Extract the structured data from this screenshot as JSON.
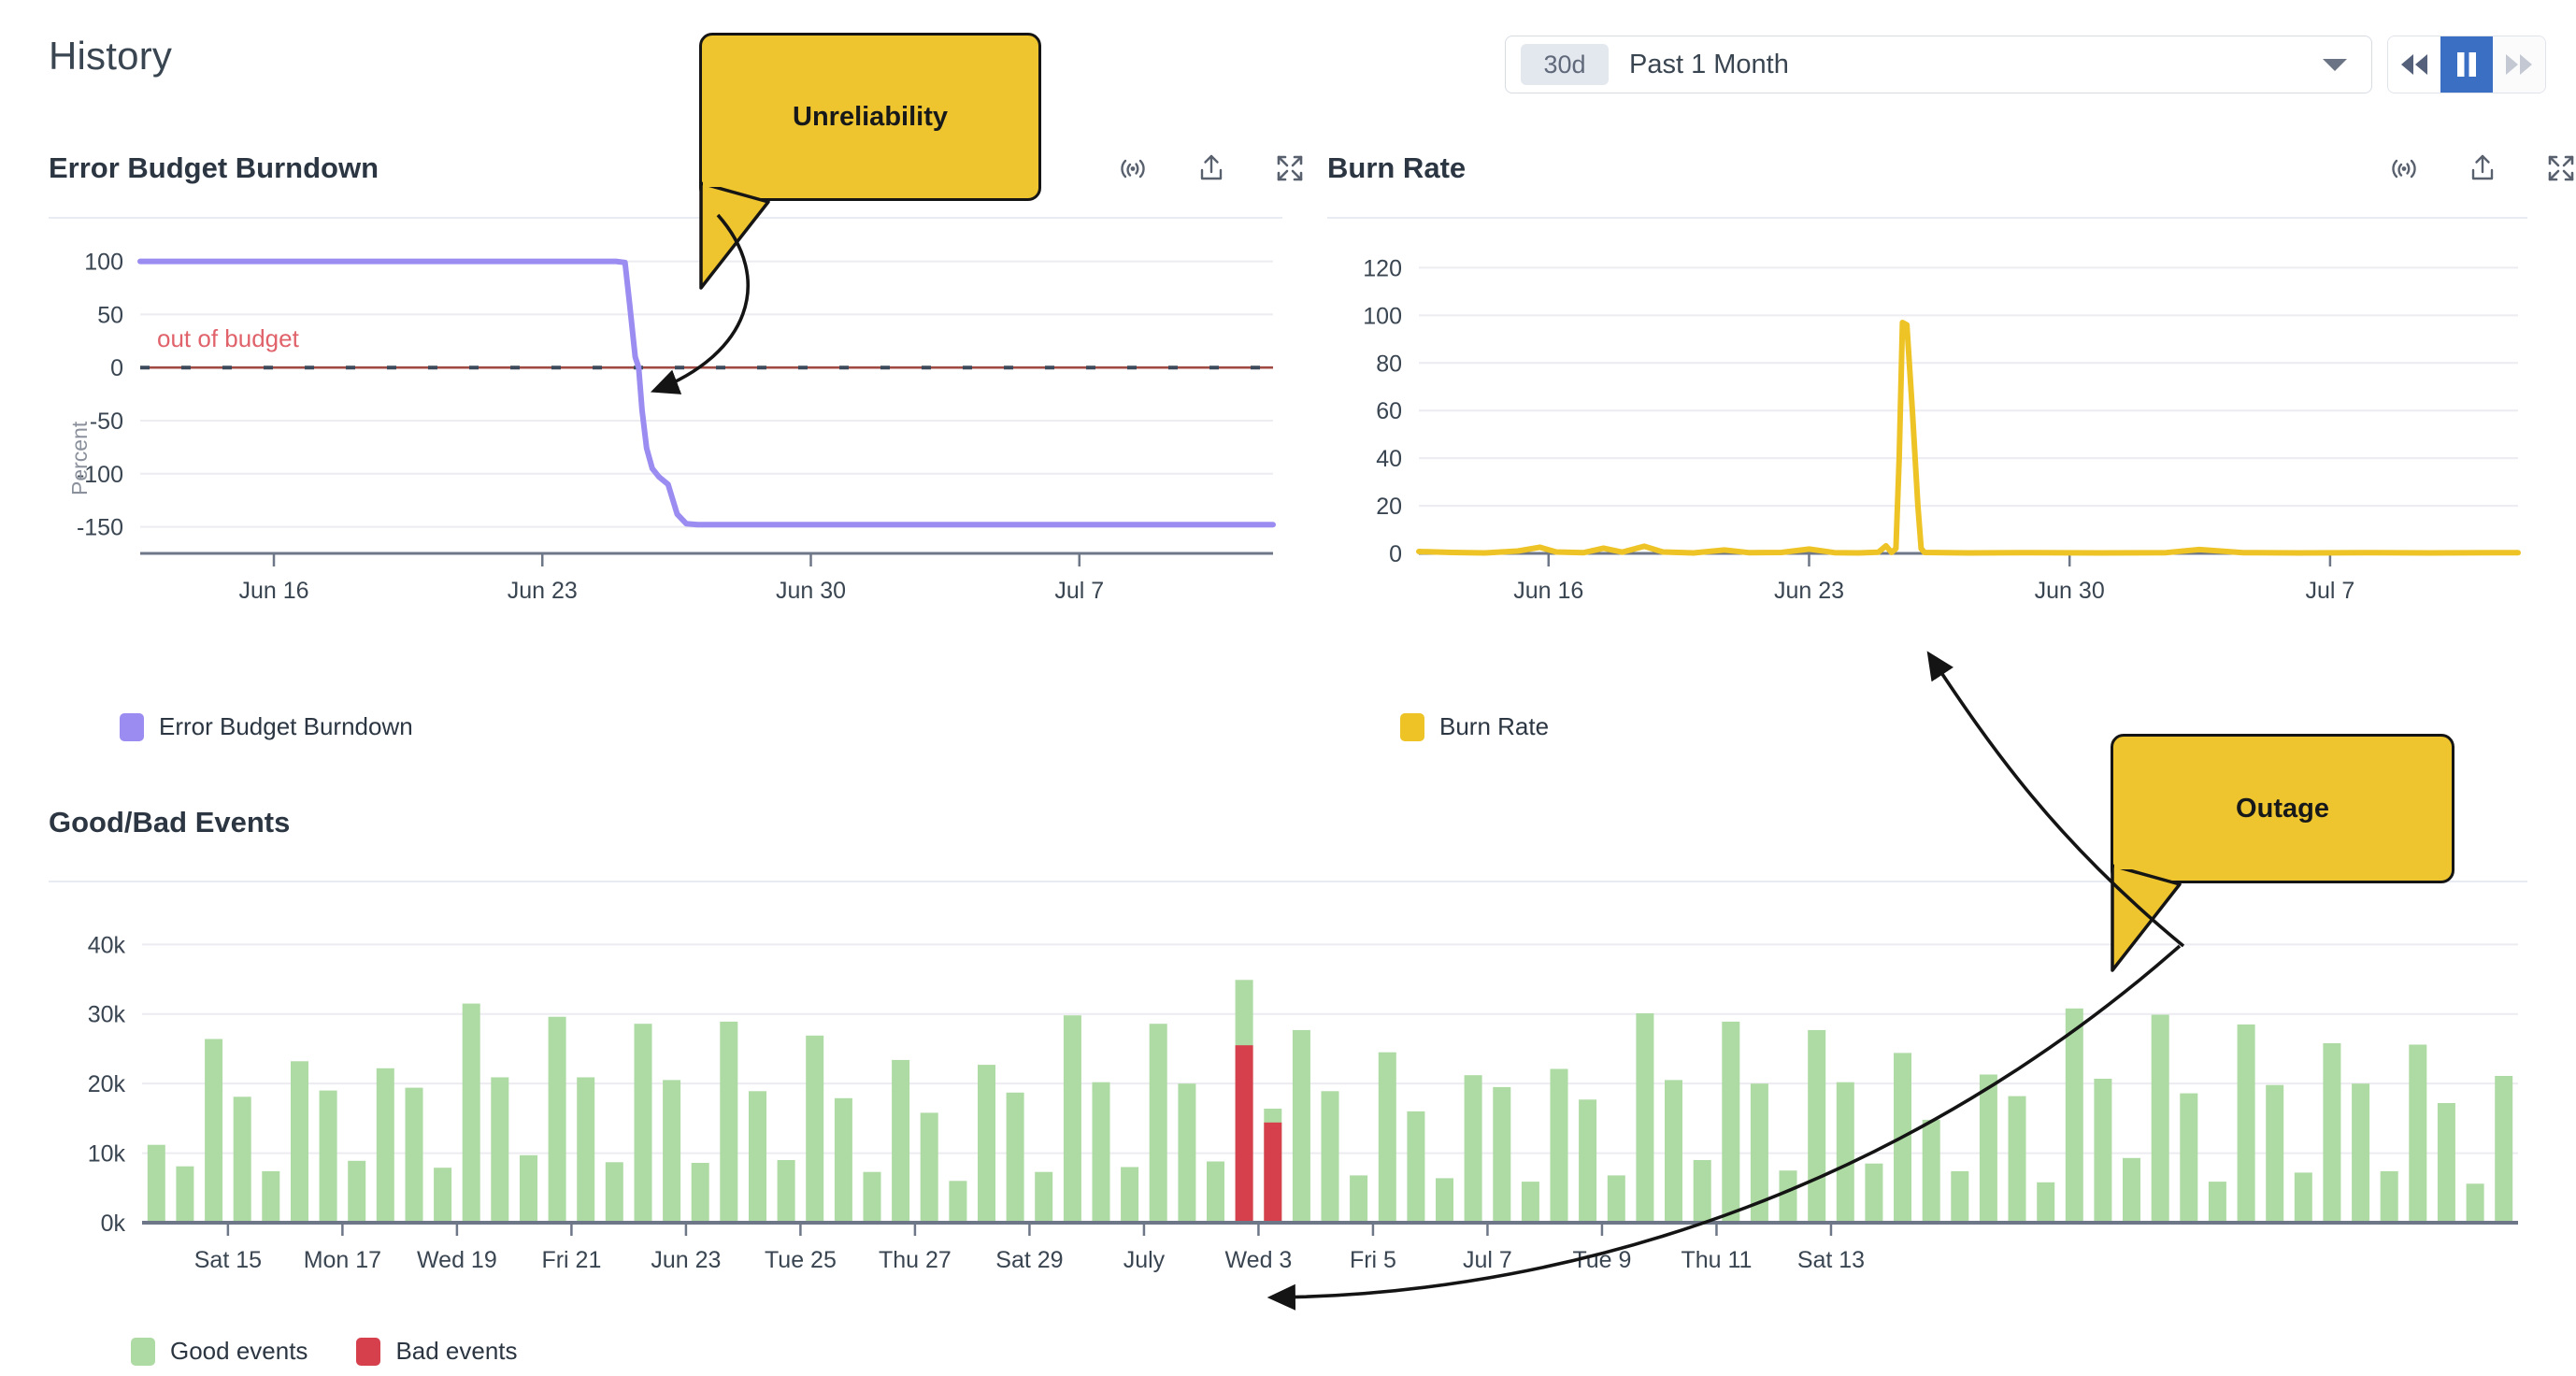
{
  "header": {
    "title": "History",
    "time_range": {
      "badge": "30d",
      "value": "Past 1 Month"
    },
    "playback": {
      "rewind_label": "rewind",
      "pause_label": "pause",
      "forward_label": "fast-forward",
      "active": "pause"
    }
  },
  "icons": {
    "radar": "radar-icon",
    "share": "share-icon",
    "expand": "expand-icon",
    "caret": "chevron-down-icon"
  },
  "colors": {
    "burndown_line": "#9a8cf0",
    "burn_rate_line": "#edc326",
    "good_events": "#aedaa3",
    "bad_events": "#d6404c",
    "out_of_budget": "#e0626a",
    "accent_blue": "#3b6fc4",
    "callout_bg": "#eec42f",
    "grid": "#ececf1",
    "axis": "#6e7788"
  },
  "callouts": [
    {
      "text": "Unreliability"
    },
    {
      "text": "Outage"
    }
  ],
  "panels": [
    {
      "id": "burndown",
      "title": "Error Budget Burndown"
    },
    {
      "id": "burnrate",
      "title": "Burn Rate"
    },
    {
      "id": "events",
      "title": "Good/Bad Events"
    }
  ],
  "chart_data": [
    {
      "id": "burndown",
      "type": "line",
      "title": "Error Budget Burndown",
      "xlabel": "",
      "ylabel": "Percent",
      "ylim": [
        -175,
        112
      ],
      "yticks": [
        100,
        50,
        0,
        -50,
        -100,
        -150
      ],
      "ytick_labels": [
        "100",
        "50",
        "0",
        "-50",
        "-100",
        "-150"
      ],
      "xtick_labels": [
        "Jun 16",
        "Jun 23",
        "Jun 30",
        "Jul 7"
      ],
      "xtick_positions": [
        0.118,
        0.355,
        0.592,
        0.829
      ],
      "grid": true,
      "legend": [
        {
          "label": "Error Budget Burndown",
          "color": "#9a8cf0"
        }
      ],
      "annotations": [
        {
          "text": "out of budget",
          "y": 0,
          "color": "#e0626a",
          "style": "dashed-threshold"
        }
      ],
      "series": [
        {
          "name": "Error Budget Burndown",
          "color": "#9a8cf0",
          "points": [
            [
              0.0,
              100
            ],
            [
              0.12,
              100
            ],
            [
              0.24,
              100
            ],
            [
              0.36,
              100
            ],
            [
              0.42,
              100
            ],
            [
              0.428,
              99
            ],
            [
              0.432,
              60
            ],
            [
              0.437,
              10
            ],
            [
              0.44,
              0
            ],
            [
              0.443,
              -40
            ],
            [
              0.447,
              -76
            ],
            [
              0.452,
              -95
            ],
            [
              0.458,
              -103
            ],
            [
              0.466,
              -110
            ],
            [
              0.474,
              -138
            ],
            [
              0.482,
              -147
            ],
            [
              0.492,
              -148
            ],
            [
              0.56,
              -148
            ],
            [
              0.68,
              -148
            ],
            [
              0.8,
              -148
            ],
            [
              0.92,
              -148
            ],
            [
              1.0,
              -148
            ]
          ]
        }
      ]
    },
    {
      "id": "burnrate",
      "type": "line",
      "title": "Burn Rate",
      "xlabel": "",
      "ylabel": "",
      "ylim": [
        0,
        128
      ],
      "yticks": [
        0,
        20,
        40,
        60,
        80,
        100,
        120
      ],
      "ytick_labels": [
        "0",
        "20",
        "40",
        "60",
        "80",
        "100",
        "120"
      ],
      "xtick_labels": [
        "Jun 16",
        "Jun 23",
        "Jun 30",
        "Jul 7"
      ],
      "xtick_positions": [
        0.118,
        0.355,
        0.592,
        0.829
      ],
      "grid": true,
      "legend": [
        {
          "label": "Burn Rate",
          "color": "#edc326"
        }
      ],
      "series": [
        {
          "name": "Burn Rate",
          "color": "#edc326",
          "points": [
            [
              0.0,
              0.8
            ],
            [
              0.03,
              0.4
            ],
            [
              0.06,
              0.2
            ],
            [
              0.09,
              1.0
            ],
            [
              0.11,
              2.6
            ],
            [
              0.125,
              0.6
            ],
            [
              0.15,
              0.3
            ],
            [
              0.168,
              2.2
            ],
            [
              0.185,
              0.5
            ],
            [
              0.205,
              3.0
            ],
            [
              0.222,
              0.6
            ],
            [
              0.25,
              0.2
            ],
            [
              0.278,
              1.4
            ],
            [
              0.3,
              0.3
            ],
            [
              0.33,
              0.4
            ],
            [
              0.355,
              1.8
            ],
            [
              0.378,
              0.3
            ],
            [
              0.4,
              0.2
            ],
            [
              0.418,
              0.5
            ],
            [
              0.425,
              3.2
            ],
            [
              0.43,
              0.4
            ],
            [
              0.434,
              2.0
            ],
            [
              0.437,
              40
            ],
            [
              0.44,
              97
            ],
            [
              0.444,
              96
            ],
            [
              0.449,
              60
            ],
            [
              0.454,
              20
            ],
            [
              0.457,
              2
            ],
            [
              0.46,
              0.4
            ],
            [
              0.5,
              0.2
            ],
            [
              0.56,
              0.3
            ],
            [
              0.62,
              0.2
            ],
            [
              0.68,
              0.3
            ],
            [
              0.71,
              1.6
            ],
            [
              0.75,
              0.3
            ],
            [
              0.8,
              0.2
            ],
            [
              0.86,
              0.3
            ],
            [
              0.92,
              0.2
            ],
            [
              1.0,
              0.3
            ]
          ]
        }
      ]
    },
    {
      "id": "events",
      "type": "bar",
      "stacked": true,
      "title": "Good/Bad Events",
      "xlabel": "",
      "ylabel": "",
      "ylim": [
        0,
        43000
      ],
      "yticks": [
        0,
        10000,
        20000,
        30000,
        40000
      ],
      "ytick_labels": [
        "0k",
        "10k",
        "20k",
        "30k",
        "40k"
      ],
      "xtick_labels": [
        "Sat 15",
        "Mon 17",
        "Wed 19",
        "Fri 21",
        "Jun 23",
        "Tue 25",
        "Thu 27",
        "Sat 29",
        "July",
        "Wed 3",
        "Fri 5",
        "Jul 7",
        "Tue 9",
        "Thu 11",
        "Sat 13"
      ],
      "xtick_bar_index": [
        3,
        7,
        11,
        15,
        19,
        23,
        27,
        31,
        35,
        39,
        43,
        47,
        51,
        55,
        59
      ],
      "grid": true,
      "legend": [
        {
          "label": "Good events",
          "color": "#aedaa3"
        },
        {
          "label": "Bad events",
          "color": "#d6404c"
        }
      ],
      "series": [
        {
          "name": "Good events",
          "color": "#aedaa3",
          "values": [
            11200,
            8100,
            26400,
            18100,
            7400,
            23200,
            19000,
            8900,
            22200,
            19400,
            7900,
            31500,
            20900,
            9700,
            29600,
            20900,
            8700,
            28600,
            20500,
            8600,
            28900,
            18900,
            9000,
            26900,
            17900,
            7300,
            23400,
            15800,
            6000,
            22700,
            18700,
            7300,
            29800,
            20200,
            8000,
            28600,
            20000,
            8800,
            34900,
            16400,
            27700,
            18900,
            6800,
            24500,
            16000,
            6400,
            21200,
            19500,
            5900,
            22100,
            17700,
            6800,
            30100,
            20500,
            9000,
            28900,
            20000,
            7500,
            27700,
            20200,
            8500,
            24400,
            14800,
            7400,
            21300,
            18200,
            5800,
            30800,
            20700,
            9300,
            29900,
            18600,
            5900,
            28500,
            19800,
            7200,
            25800,
            20000,
            7400,
            25600,
            17200,
            5600,
            21100
          ]
        },
        {
          "name": "Bad events",
          "color": "#d6404c",
          "values": [
            0,
            0,
            0,
            0,
            0,
            0,
            0,
            0,
            0,
            0,
            0,
            0,
            0,
            0,
            0,
            0,
            0,
            0,
            0,
            0,
            0,
            0,
            0,
            0,
            0,
            0,
            0,
            0,
            0,
            0,
            0,
            0,
            0,
            0,
            0,
            0,
            0,
            0,
            25500,
            14400,
            0,
            0,
            0,
            0,
            0,
            0,
            0,
            0,
            0,
            0,
            0,
            0,
            0,
            0,
            0,
            0,
            0,
            0,
            0,
            0,
            0,
            0,
            0,
            0,
            0,
            0,
            0,
            0,
            0,
            0,
            0,
            0,
            0,
            0,
            0,
            0,
            0,
            0,
            0,
            0,
            0,
            0,
            0
          ]
        }
      ]
    }
  ]
}
